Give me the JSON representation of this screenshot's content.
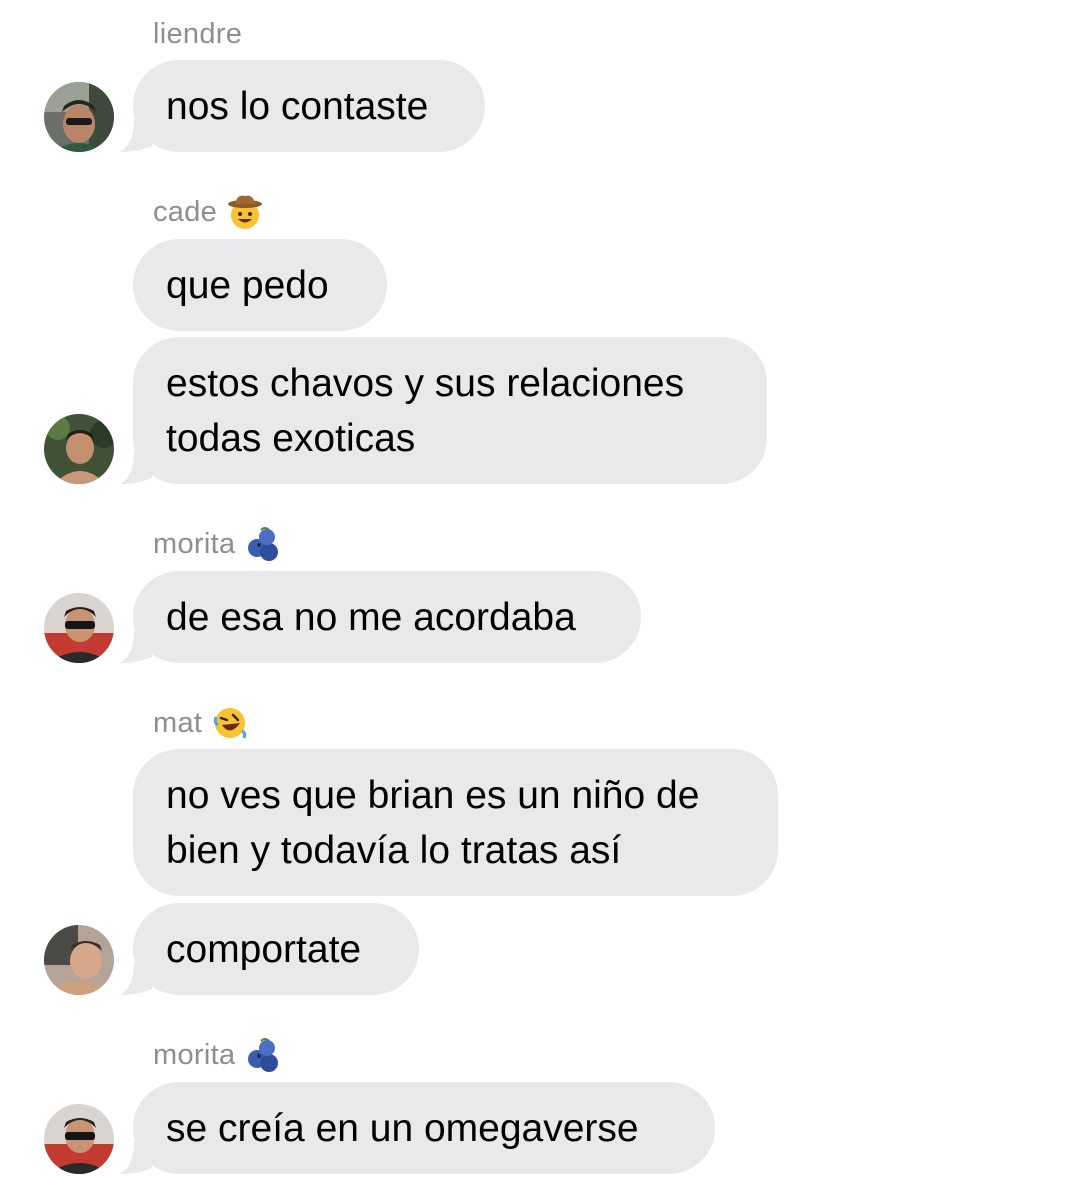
{
  "messages": [
    {
      "sender": "liendre",
      "sender_emoji": "",
      "text_lines": [
        "nos lo contaste"
      ]
    },
    {
      "sender": "cade",
      "sender_emoji": "cowboy-hat-face-icon",
      "text_lines": [
        "que pedo"
      ]
    },
    {
      "sender": "",
      "sender_emoji": "",
      "text_lines": [
        "estos chavos y sus relaciones",
        "todas exoticas"
      ]
    },
    {
      "sender": "morita",
      "sender_emoji": "blueberries-icon",
      "text_lines": [
        "de esa no me acordaba"
      ]
    },
    {
      "sender": "mat",
      "sender_emoji": "rolling-on-floor-laughing-icon",
      "text_lines": [
        "no ves que brian es un niño de",
        "bien y todavía lo tratas así"
      ]
    },
    {
      "sender": "",
      "sender_emoji": "",
      "text_lines": [
        "comportate"
      ]
    },
    {
      "sender": "morita",
      "sender_emoji": "blueberries-icon",
      "text_lines": [
        "se creía en un omegaverse"
      ]
    }
  ],
  "colors": {
    "bubble": "#e9e9eb",
    "sender_name": "#8e8e93",
    "text": "#000000",
    "background": "#ffffff"
  }
}
